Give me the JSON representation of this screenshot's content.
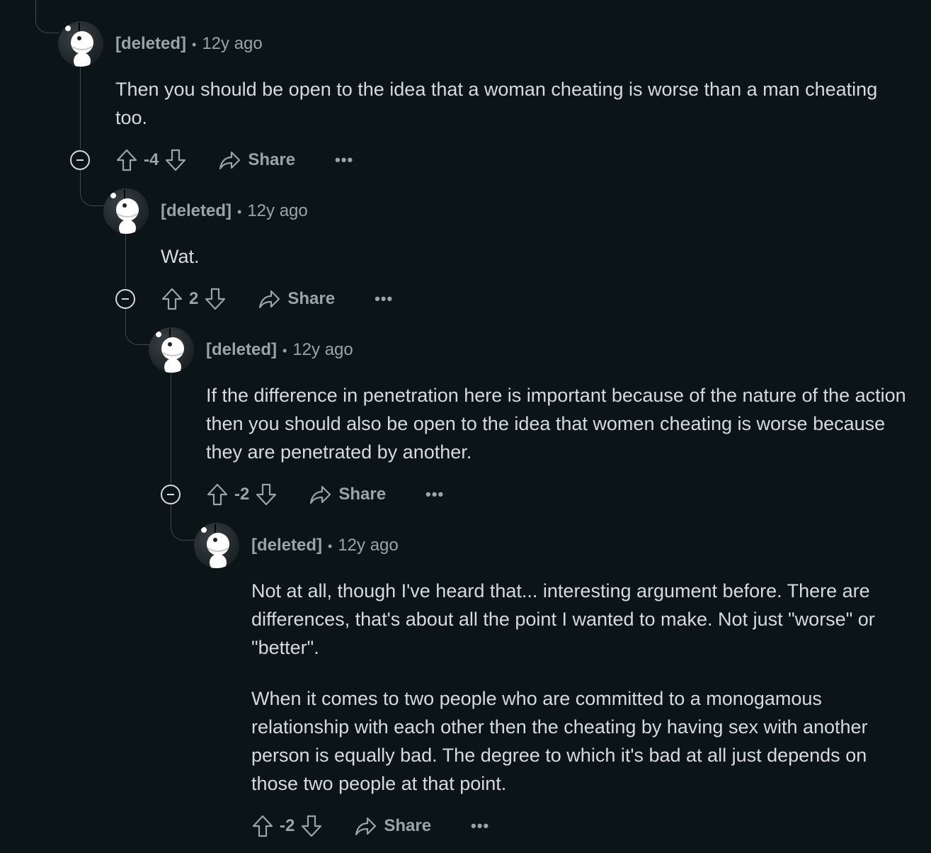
{
  "comments": [
    {
      "author": "[deleted]",
      "separator": "•",
      "time": "12y ago",
      "paragraphs": [
        "Then you should be open to the idea that a woman cheating is worse than a man cheating too."
      ],
      "score": "-4",
      "share_label": "Share",
      "more_label": "•••"
    },
    {
      "author": "[deleted]",
      "separator": "•",
      "time": "12y ago",
      "paragraphs": [
        "Wat."
      ],
      "score": "2",
      "share_label": "Share",
      "more_label": "•••"
    },
    {
      "author": "[deleted]",
      "separator": "•",
      "time": "12y ago",
      "paragraphs": [
        "If the difference in penetration here is important because of the nature of the action then you should also be open to the idea that women cheating is worse because they are penetrated by another."
      ],
      "score": "-2",
      "share_label": "Share",
      "more_label": "•••"
    },
    {
      "author": "[deleted]",
      "separator": "•",
      "time": "12y ago",
      "paragraphs": [
        "Not at all, though I've heard that... interesting argument before. There are differences, that's about all the point I wanted to make. Not just \"worse\" or \"better\".",
        "When it comes to two people who are committed to a monogamous relationship with each other then the cheating by having sex with another person is equally bad. The degree to which it's bad at all just depends on those two people at that point."
      ],
      "score": "-2",
      "share_label": "Share",
      "more_label": "•••"
    }
  ],
  "colors": {
    "background": "#0b1416",
    "text": "#d7dadc",
    "muted": "#9aa4a7",
    "thread_line": "#3e4a4d"
  },
  "icons": [
    "upvote-icon",
    "downvote-icon",
    "share-icon",
    "collapse-icon",
    "avatar-snoo-icon"
  ]
}
